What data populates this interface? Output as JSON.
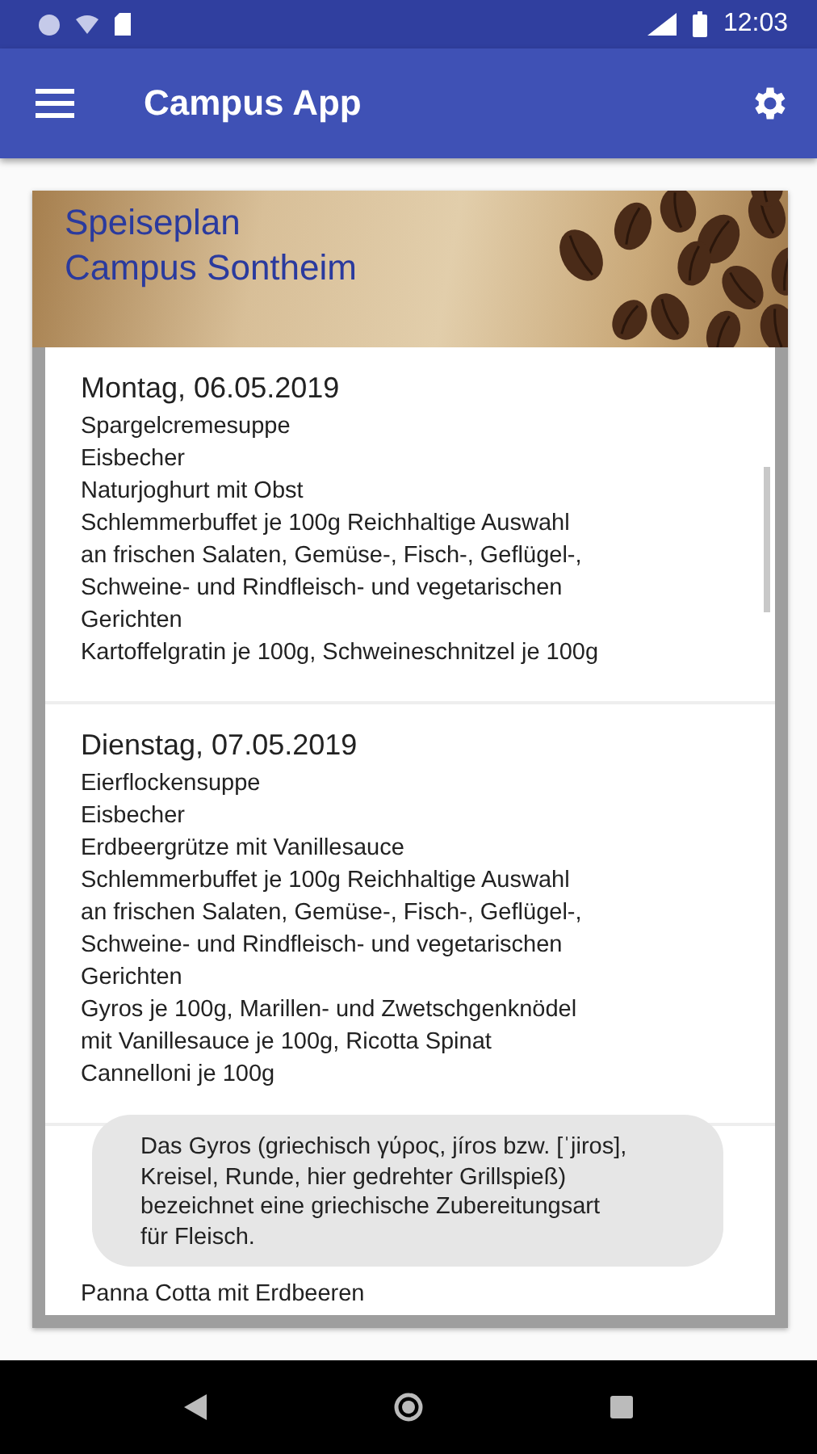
{
  "status_bar": {
    "time": "12:03"
  },
  "app_bar": {
    "title": "Campus App"
  },
  "header": {
    "lines": [
      "Speiseplan",
      "Campus Sontheim"
    ]
  },
  "days": [
    {
      "title": "Montag, 06.05.2019",
      "items": [
        "Spargelcremesuppe",
        "Eisbecher",
        "Naturjoghurt mit Obst",
        "Schlemmerbuffet je 100g Reichhaltige Auswahl an frischen Salaten, Gemüse-, Fisch-, Geflügel-, Schweine- und Rindfleisch- und vegetarischen Gerichten",
        "Kartoffelgratin je 100g, Schweineschnitzel je 100g"
      ]
    },
    {
      "title": "Dienstag, 07.05.2019",
      "items": [
        "Eierflockensuppe",
        "Eisbecher",
        "Erdbeergrütze mit Vanillesauce",
        "Schlemmerbuffet je 100g Reichhaltige Auswahl an frischen Salaten, Gemüse-, Fisch-, Geflügel-, Schweine- und Rindfleisch- und vegetarischen Gerichten",
        "Gyros je 100g, Marillen- und Zwetschgenknödel mit Vanillesauce je 100g, Ricotta Spinat Cannelloni je 100g"
      ]
    },
    {
      "items": [
        "Panna Cotta mit Erdbeeren"
      ]
    }
  ],
  "toast": {
    "text": "Das Gyros (griechisch γύρος, jíros bzw. [ˈjiros], Kreisel, Runde, hier gedrehter Grillspieß) bezeichnet eine griechische Zubereitungsart für Fleisch."
  }
}
